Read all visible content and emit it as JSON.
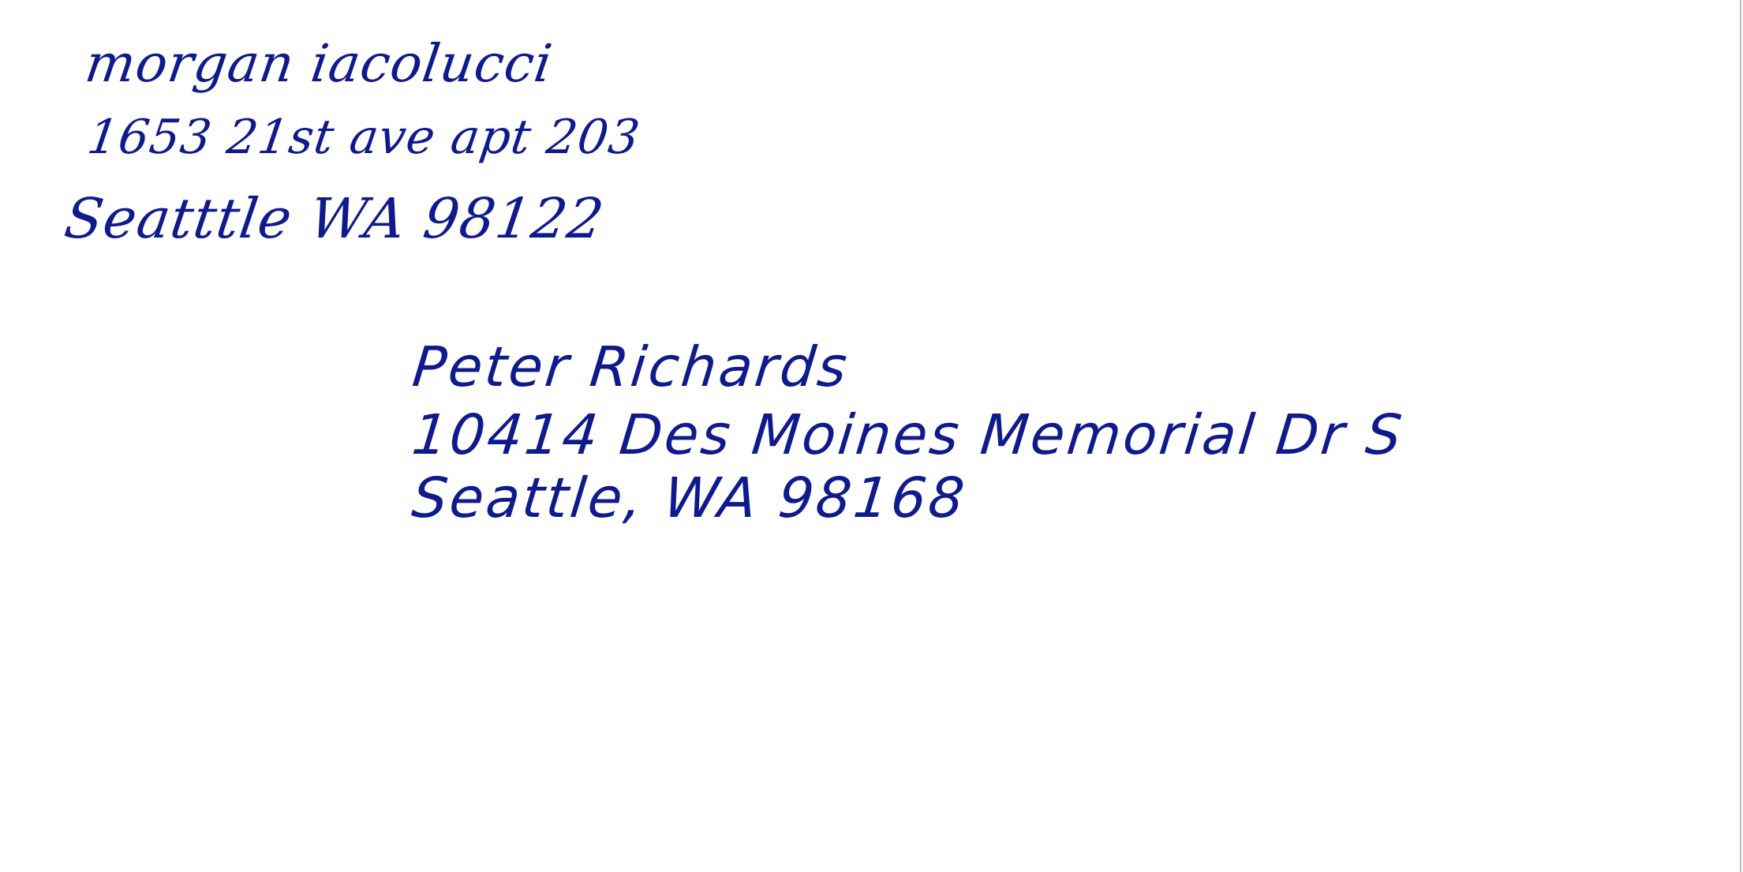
{
  "return_address": {
    "name": "morgan iacolucci",
    "street": "1653 21st ave apt 203",
    "city_state_zip": "Seatttle WA 98122"
  },
  "recipient_address": {
    "name": "Peter Richards",
    "street": "10414 Des Moines Memorial Dr S",
    "city_state_zip": "Seattle, WA 98168"
  },
  "colors": {
    "ink": "#0f1a8c",
    "paper": "#ffffff"
  }
}
